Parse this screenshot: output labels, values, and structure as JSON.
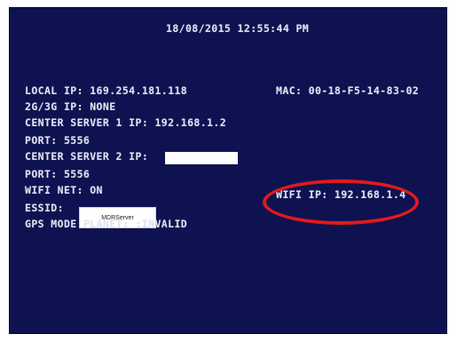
{
  "screen": {
    "datetime": "18/08/2015 12:55:44 PM",
    "lines": {
      "local_ip": "LOCAL IP: 169.254.181.118",
      "mac": "MAC: 00-18-F5-14-83-02",
      "cellular_ip": "2G/3G IP: NONE",
      "center_server_1": "CENTER SERVER 1 IP: 192.168.1.2",
      "port_1": "PORT: 5556",
      "center_server_2": "CENTER SERVER 2 IP:",
      "port_2": "PORT: 5556",
      "wifi_net": "WIFI NET: ON",
      "wifi_ip": "WIFI IP: 192.168.1.4",
      "essid_label": "ESSID:",
      "essid_value": "MDRServer",
      "gps_mode": "GPS MODE PLANET: :INVALID"
    }
  },
  "colors": {
    "background": "#0e1251",
    "text": "#dfe1f0",
    "annotation": "#e2191b"
  }
}
